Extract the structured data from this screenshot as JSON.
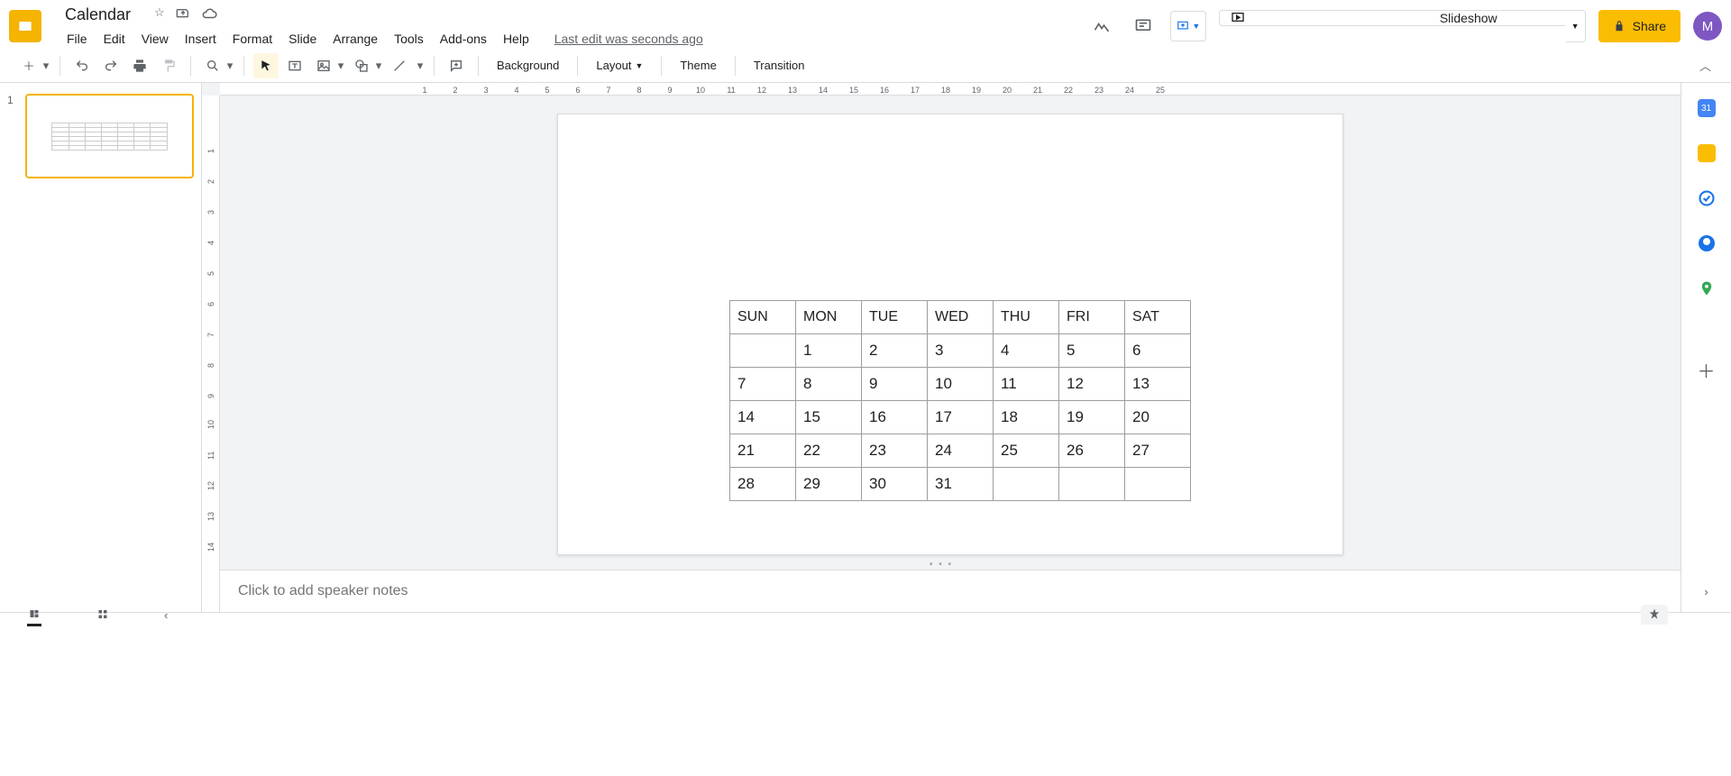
{
  "doc": {
    "title": "Calendar"
  },
  "last_edit": "Last edit was seconds ago",
  "menu": [
    "File",
    "Edit",
    "View",
    "Insert",
    "Format",
    "Slide",
    "Arrange",
    "Tools",
    "Add-ons",
    "Help"
  ],
  "header_buttons": {
    "slideshow": "Slideshow",
    "share": "Share"
  },
  "avatar_letter": "M",
  "toolbar": {
    "background": "Background",
    "layout": "Layout",
    "theme": "Theme",
    "transition": "Transition"
  },
  "filmstrip": {
    "slide1_num": "1"
  },
  "calendar": {
    "headers": [
      "SUN",
      "MON",
      "TUE",
      "WED",
      "THU",
      "FRI",
      "SAT"
    ],
    "rows": [
      [
        "",
        "1",
        "2",
        "3",
        "4",
        "5",
        "6"
      ],
      [
        "7",
        "8",
        "9",
        "10",
        "11",
        "12",
        "13"
      ],
      [
        "14",
        "15",
        "16",
        "17",
        "18",
        "19",
        "20"
      ],
      [
        "21",
        "22",
        "23",
        "24",
        "25",
        "26",
        "27"
      ],
      [
        "28",
        "29",
        "30",
        "31",
        "",
        "",
        ""
      ]
    ]
  },
  "notes_placeholder": "Click to add speaker notes",
  "ruler_h": [
    "1",
    "2",
    "3",
    "4",
    "5",
    "6",
    "7",
    "8",
    "9",
    "10",
    "11",
    "12",
    "13",
    "14",
    "15",
    "16",
    "17",
    "18",
    "19",
    "20",
    "21",
    "22",
    "23",
    "24",
    "25"
  ],
  "ruler_v": [
    "1",
    "2",
    "3",
    "4",
    "5",
    "6",
    "7",
    "8",
    "9",
    "10",
    "11",
    "12",
    "13",
    "14"
  ],
  "sidepanel_cal_day": "31"
}
